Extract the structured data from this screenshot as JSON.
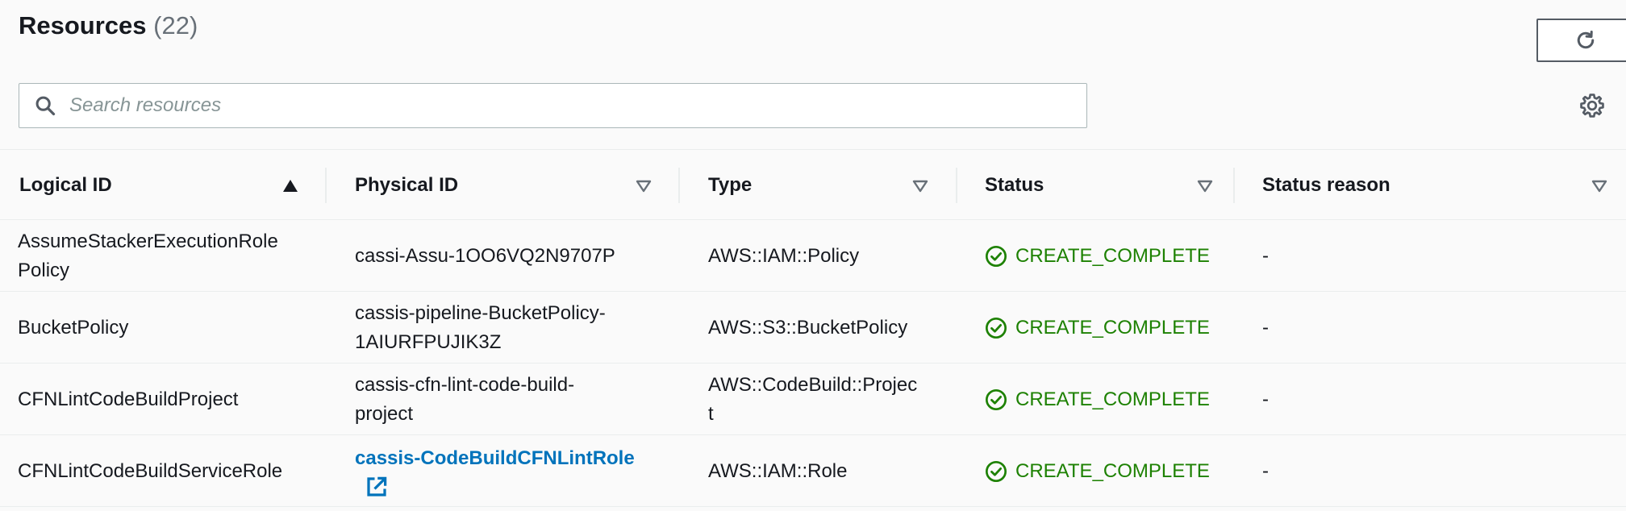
{
  "header": {
    "title": "Resources",
    "count": "(22)"
  },
  "search": {
    "placeholder": "Search resources",
    "value": ""
  },
  "columns": [
    {
      "label": "Logical ID",
      "sort": "ascending"
    },
    {
      "label": "Physical ID",
      "sort": "none"
    },
    {
      "label": "Type",
      "sort": "none"
    },
    {
      "label": "Status",
      "sort": "none"
    },
    {
      "label": "Status reason",
      "sort": "none"
    }
  ],
  "rows": [
    {
      "logical_id_line1": "AssumeStackerExecutionRole",
      "logical_id_line2": "Policy",
      "physical_id_line1": "cassi-Assu-1OO6VQ2N9707P",
      "physical_id_line2": "",
      "type_line1": "AWS::IAM::Policy",
      "type_line2": "",
      "status": "CREATE_COMPLETE",
      "status_reason": "-"
    },
    {
      "logical_id_line1": "BucketPolicy",
      "logical_id_line2": "",
      "physical_id_line1": "cassis-pipeline-BucketPolicy-",
      "physical_id_line2": "1AIURFPUJIK3Z",
      "type_line1": "AWS::S3::BucketPolicy",
      "type_line2": "",
      "status": "CREATE_COMPLETE",
      "status_reason": "-"
    },
    {
      "logical_id_line1": "CFNLintCodeBuildProject",
      "logical_id_line2": "",
      "physical_id_line1": "cassis-cfn-lint-code-build-",
      "physical_id_line2": "project",
      "type_line1": "AWS::CodeBuild::Projec",
      "type_line2": "t",
      "status": "CREATE_COMPLETE",
      "status_reason": "-"
    },
    {
      "logical_id_line1": "CFNLintCodeBuildServiceRole",
      "logical_id_line2": "",
      "physical_id_link": "cassis-CodeBuildCFNLintRole",
      "type_line1": "AWS::IAM::Role",
      "type_line2": "",
      "status": "CREATE_COMPLETE",
      "status_reason": "-"
    }
  ],
  "colors": {
    "status_success": "#1d8102",
    "link": "#0073bb",
    "header_count": "#687078"
  },
  "icons": [
    "refresh-icon",
    "search-icon",
    "gear-icon",
    "sort-ascending-icon",
    "sort-descending-icon",
    "check-circle-icon",
    "external-link-icon"
  ]
}
